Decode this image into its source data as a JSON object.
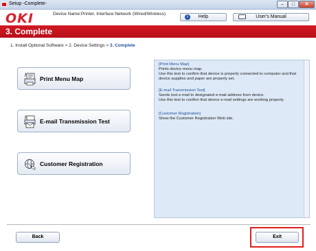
{
  "window": {
    "title": "Setup -Complete-",
    "controls": {
      "minimize": "–",
      "maximize": "□",
      "close": "✕"
    }
  },
  "header": {
    "logo": "OKI",
    "device_name": "Device Name:Printer, Interface:Network (Wired/Wireless)",
    "help_label": "Help",
    "manual_label": "User's Manual"
  },
  "banner": {
    "title": "3. Complete"
  },
  "breadcrumb": {
    "steps": "1. Install Optional Software > 2. Device Settings > ",
    "current": "3. Complete"
  },
  "menu": {
    "items": [
      {
        "label": "Print Menu Map",
        "icon": "printer-menu-map-icon"
      },
      {
        "label": "E-mail Transmission Test",
        "icon": "printer-email-icon"
      },
      {
        "label": "Customer Registration",
        "icon": "globe-registration-icon"
      }
    ]
  },
  "info": {
    "sections": [
      {
        "heading": "[Print Menu Map]",
        "lines": [
          "Prints device menu map.",
          "Use this test to confirm that device is properly connected to computer and that device supplies and paper are properly set."
        ]
      },
      {
        "heading": "[E-mail Transmission Test]",
        "lines": [
          "Sends test e-mail to designated e-mail address from device.",
          "Use this test to confirm that device e-mail settings are working properly."
        ]
      },
      {
        "heading": "[Customer Registration]",
        "lines": [
          "Show the Customer Registration Web site."
        ]
      }
    ]
  },
  "footer": {
    "back_label": "Back",
    "exit_label": "Exit"
  },
  "colors": {
    "brand_red": "#d11a24",
    "link_blue": "#1f4f9c",
    "highlight_red": "#e11d1d",
    "info_bg": "#dde9f6"
  }
}
